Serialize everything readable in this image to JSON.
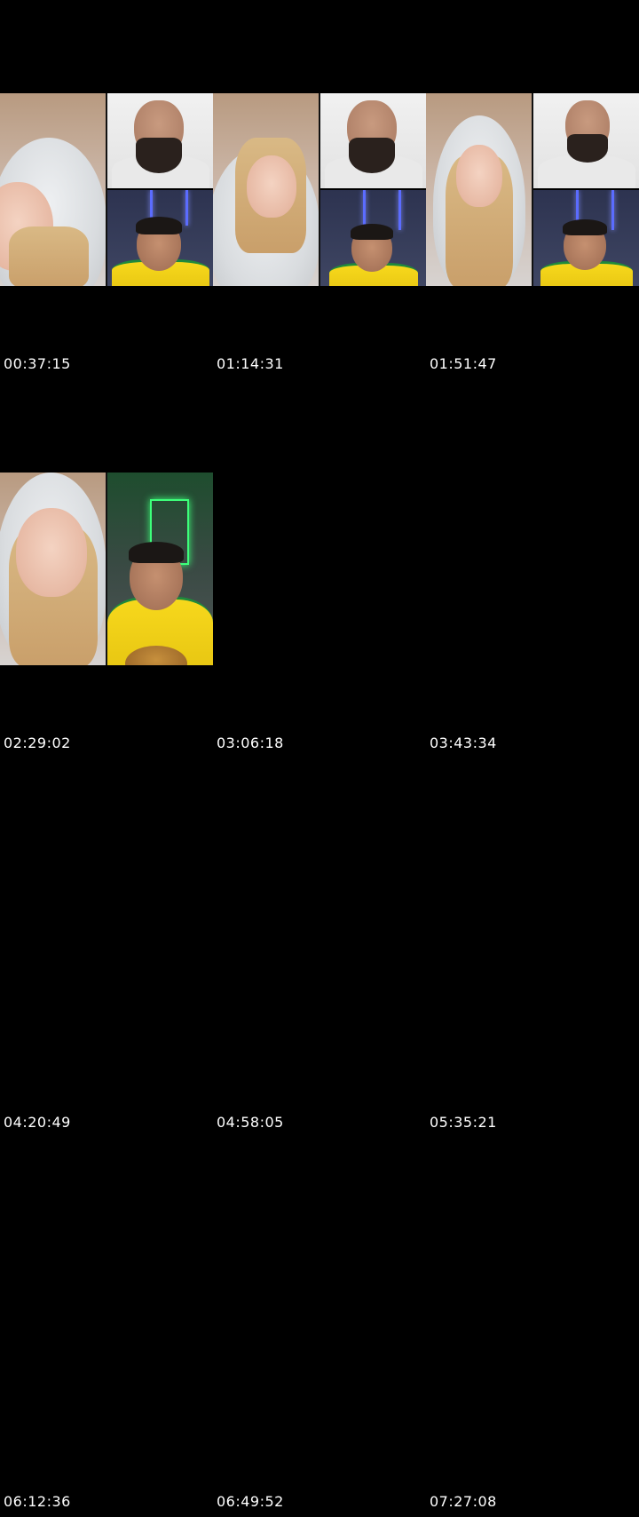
{
  "timestamps": [
    "00:37:15",
    "01:14:31",
    "01:51:47",
    "02:29:02",
    "03:06:18",
    "03:43:34",
    "04:20:49",
    "04:58:05",
    "05:35:21",
    "06:12:36",
    "06:49:52",
    "07:27:08"
  ],
  "icons": {
    "thumbnail": "video-frame-thumbnail"
  },
  "colors": {
    "background": "#000000",
    "text": "#ffffff",
    "jersey_yellow": "#f7d81c",
    "jersey_green": "#1f8a3b",
    "neon_blue": "#5b6cff",
    "neon_green": "#3dff7a"
  }
}
